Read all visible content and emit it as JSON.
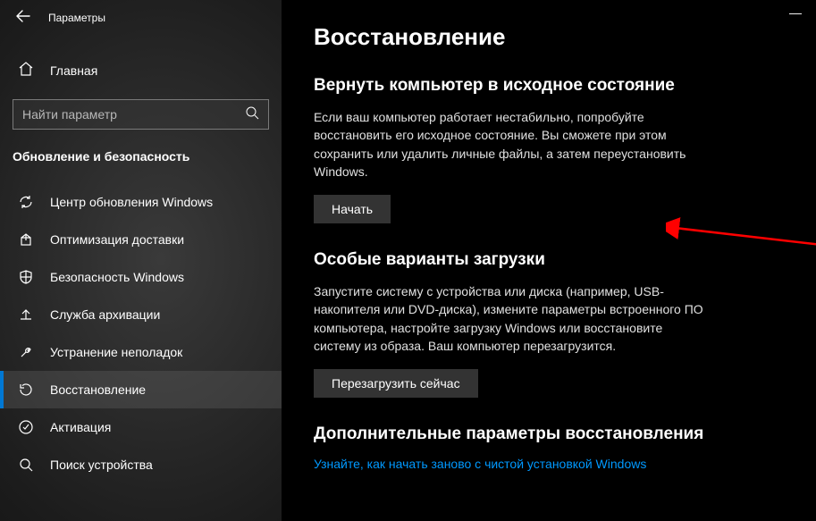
{
  "window": {
    "title": "Параметры",
    "minimize": "—"
  },
  "sidebar": {
    "home": "Главная",
    "search_placeholder": "Найти параметр",
    "section_heading": "Обновление и безопасность",
    "items": [
      {
        "label": "Центр обновления Windows"
      },
      {
        "label": "Оптимизация доставки"
      },
      {
        "label": "Безопасность Windows"
      },
      {
        "label": "Служба архивации"
      },
      {
        "label": "Устранение неполадок"
      },
      {
        "label": "Восстановление"
      },
      {
        "label": "Активация"
      },
      {
        "label": "Поиск устройства"
      }
    ]
  },
  "main": {
    "page_title": "Восстановление",
    "reset": {
      "heading": "Вернуть компьютер в исходное состояние",
      "body": "Если ваш компьютер работает нестабильно, попробуйте восстановить его исходное состояние. Вы сможете при этом сохранить или удалить личные файлы, а затем переустановить Windows.",
      "button": "Начать"
    },
    "advanced_startup": {
      "heading": "Особые варианты загрузки",
      "body": "Запустите систему с устройства или диска (например, USB-накопителя или DVD-диска), измените параметры встроенного ПО компьютера, настройте загрузку Windows или восстановите систему из образа. Ваш компьютер перезагрузится.",
      "button": "Перезагрузить сейчас"
    },
    "more": {
      "heading": "Дополнительные параметры восстановления",
      "link": "Узнайте, как начать заново с чистой установкой Windows"
    }
  }
}
